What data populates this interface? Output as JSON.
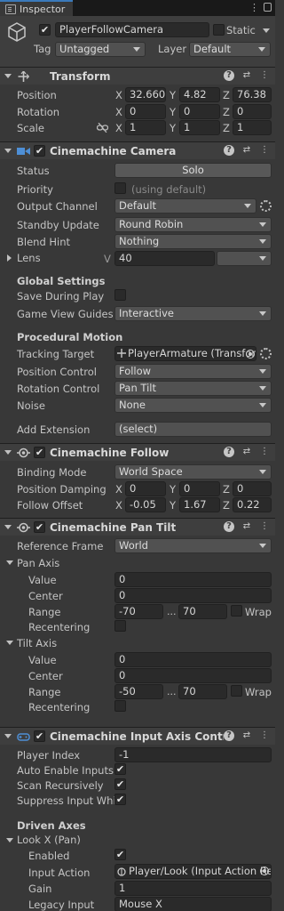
{
  "window": {
    "tab_label": "Inspector"
  },
  "header": {
    "object_name": "PlayerFollowCamera",
    "static_label": "Static",
    "tag_label": "Tag",
    "tag_value": "Untagged",
    "layer_label": "Layer",
    "layer_value": "Default"
  },
  "transform": {
    "title": "Transform",
    "position_label": "Position",
    "rotation_label": "Rotation",
    "scale_label": "Scale",
    "position": {
      "x": "32.660",
      "y": "4.82",
      "z": "76.38"
    },
    "rotation": {
      "x": "0",
      "y": "0",
      "z": "0"
    },
    "scale": {
      "x": "1",
      "y": "1",
      "z": "1"
    },
    "axis_x": "X",
    "axis_y": "Y",
    "axis_z": "Z"
  },
  "cinemachine_camera": {
    "title": "Cinemachine Camera",
    "status_label": "Status",
    "status_button": "Solo",
    "priority_label": "Priority",
    "priority_hint": "(using default)",
    "output_channel_label": "Output Channel",
    "output_channel_value": "Default",
    "standby_label": "Standby Update",
    "standby_value": "Round Robin",
    "blend_label": "Blend Hint",
    "blend_value": "Nothing",
    "lens_label": "Lens",
    "lens_v": "V",
    "lens_value": "40",
    "global_settings": "Global Settings",
    "save_play_label": "Save During Play",
    "guides_label": "Game View Guides",
    "guides_value": "Interactive",
    "procedural_motion": "Procedural Motion",
    "tracking_label": "Tracking Target",
    "tracking_value": "PlayerArmature (Transfor",
    "position_control_label": "Position Control",
    "position_control_value": "Follow",
    "rotation_control_label": "Rotation Control",
    "rotation_control_value": "Pan Tilt",
    "noise_label": "Noise",
    "noise_value": "None",
    "add_extension_label": "Add Extension",
    "add_extension_value": "(select)"
  },
  "cinemachine_follow": {
    "title": "Cinemachine Follow",
    "binding_label": "Binding Mode",
    "binding_value": "World Space",
    "damping_label": "Position Damping",
    "damping": {
      "x": "0",
      "y": "0",
      "z": "0"
    },
    "offset_label": "Follow Offset",
    "offset": {
      "x": "-0.05",
      "y": "1.67",
      "z": "0.22"
    }
  },
  "cinemachine_pan_tilt": {
    "title": "Cinemachine Pan Tilt",
    "ref_frame_label": "Reference Frame",
    "ref_frame_value": "World",
    "pan_axis_label": "Pan Axis",
    "pan": {
      "value_label": "Value",
      "value": "0",
      "center_label": "Center",
      "center": "0",
      "range_label": "Range",
      "range_min": "-70",
      "range_max": "70",
      "wrap_label": "Wrap",
      "recentering_label": "Recentering"
    },
    "tilt_axis_label": "Tilt Axis",
    "tilt": {
      "value_label": "Value",
      "value": "0",
      "center_label": "Center",
      "center": "0",
      "range_label": "Range",
      "range_min": "-50",
      "range_max": "70",
      "wrap_label": "Wrap",
      "recentering_label": "Recentering"
    },
    "range_sep": "..."
  },
  "cinemachine_input": {
    "title": "Cinemachine Input Axis Controlle",
    "player_index_label": "Player Index",
    "player_index_value": "-1",
    "auto_enable_label": "Auto Enable Inputs",
    "scan_label": "Scan Recursively",
    "suppress_label": "Suppress Input While",
    "driven_axes": "Driven Axes",
    "look_x_label": "Look X (Pan)",
    "enabled_label": "Enabled",
    "input_action_label": "Input Action",
    "input_action_value": "Player/Look (Input Action Re",
    "gain_label": "Gain",
    "gain_value": "1",
    "legacy_label": "Legacy Input",
    "legacy_value": "Mouse X"
  },
  "check_mark": "✔"
}
